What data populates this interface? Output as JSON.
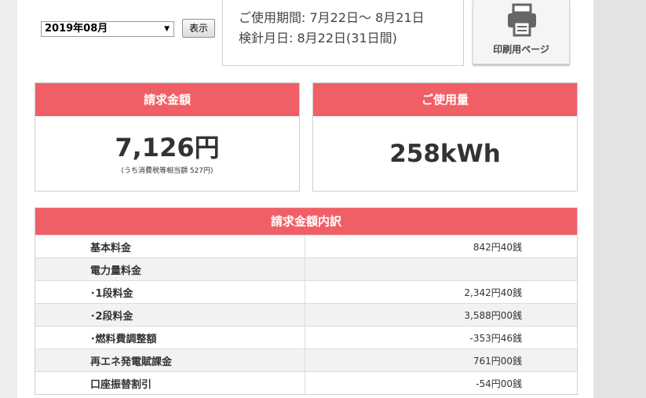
{
  "controls": {
    "month_value": "2019年08月",
    "show_label": "表示"
  },
  "period": {
    "usage_period": "ご使用期間: 7月22日～ 8月21日",
    "reading_date": "検針月日: 8月22日(31日間)"
  },
  "print": {
    "label": "印刷用ページ"
  },
  "billing": {
    "title": "請求金額",
    "amount": "7,126円",
    "tax_note": "(うち消費税等相当額 527円)"
  },
  "usage": {
    "title": "ご使用量",
    "amount": "258kWh"
  },
  "breakdown": {
    "title": "請求金額内訳",
    "rows": [
      {
        "label": "基本料金",
        "value": "842円40銭"
      },
      {
        "label": "電力量料金",
        "value": ""
      },
      {
        "label": "･1段料金",
        "value": "2,342円40銭"
      },
      {
        "label": "･2段料金",
        "value": "3,588円00銭"
      },
      {
        "label": "･燃料費調整額",
        "value": "-353円46銭"
      },
      {
        "label": "再エネ発電賦課金",
        "value": "761円00銭"
      },
      {
        "label": "口座振替割引",
        "value": "-54円00銭"
      }
    ]
  },
  "colors": {
    "accent": "#f15f66"
  }
}
